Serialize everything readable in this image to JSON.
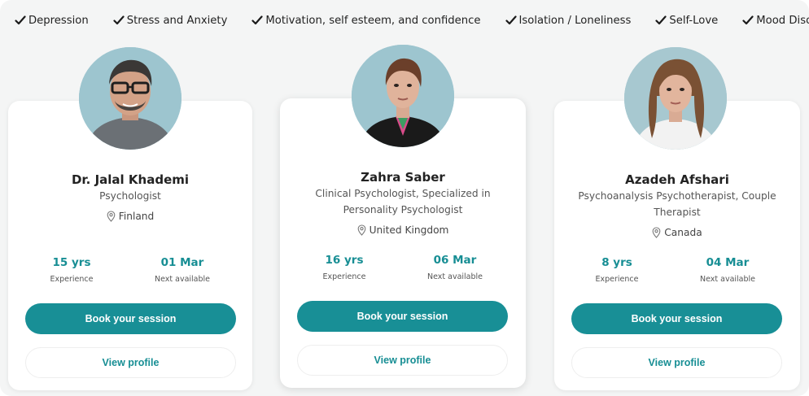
{
  "tags": [
    {
      "label": "Depression",
      "icon": "check-icon"
    },
    {
      "label": "Stress and Anxiety",
      "icon": "check-icon"
    },
    {
      "label": "Motivation, self esteem, and confidence",
      "icon": "check-icon"
    },
    {
      "label": "Isolation / Loneliness",
      "icon": "check-icon"
    },
    {
      "label": "Self-Love",
      "icon": "check-icon"
    },
    {
      "label": "Mood Disorders",
      "icon": "check-icon"
    }
  ],
  "colors": {
    "accent": "#188f96",
    "accent_text": "#178e94",
    "avatar_bg": "#9dc5cf",
    "page_bg": "#f4f5f5"
  },
  "therapists": [
    {
      "name": "Dr. Jalal Khademi",
      "role": "Psychologist",
      "location": "Finland",
      "experience_value": "15 yrs",
      "experience_label": "Experience",
      "availability_value": "01 Mar",
      "availability_label": "Next available",
      "book_label": "Book your session",
      "view_label": "View profile"
    },
    {
      "name": "Zahra Saber",
      "role": "Clinical Psychologist, Specialized in Personality Psychologist",
      "location": "United Kingdom",
      "experience_value": "16 yrs",
      "experience_label": "Experience",
      "availability_value": "06 Mar",
      "availability_label": "Next available",
      "book_label": "Book your session",
      "view_label": "View profile"
    },
    {
      "name": "Azadeh Afshari",
      "role": "Psychoanalysis Psychotherapist, Couple Therapist",
      "location": "Canada",
      "experience_value": "8 yrs",
      "experience_label": "Experience",
      "availability_value": "04 Mar",
      "availability_label": "Next available",
      "book_label": "Book your session",
      "view_label": "View profile"
    }
  ]
}
